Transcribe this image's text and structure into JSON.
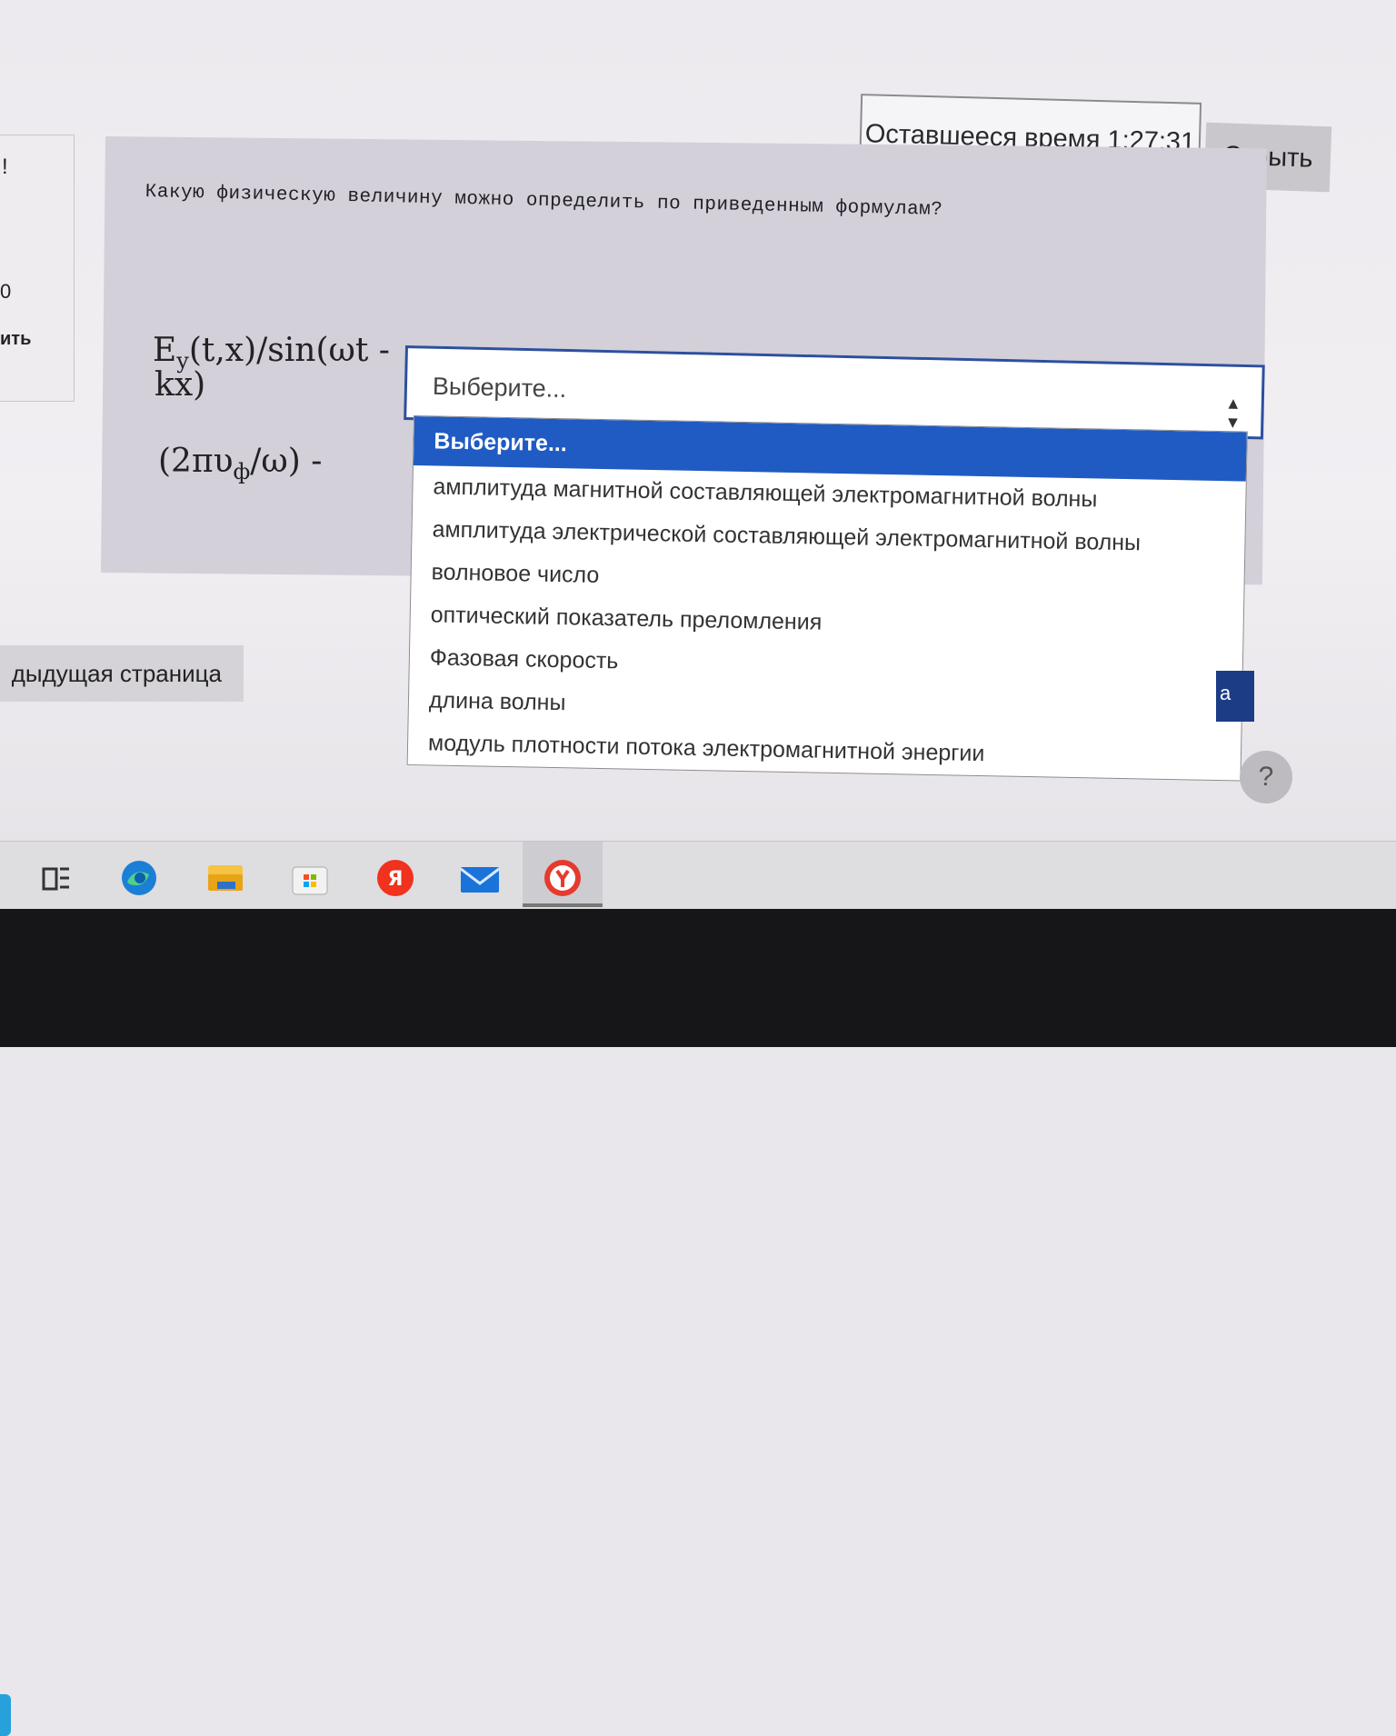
{
  "left_nav": {
    "number": "0",
    "link_fragment": "ить"
  },
  "timer": {
    "label": "Оставшееся время 1:27:31",
    "hide_button": "Скрыть"
  },
  "question": {
    "text": "Какую физическую величину можно определить по приведенным формулам?",
    "formula1_line1": "E",
    "formula1_sub": "y",
    "formula1_rest1": "(t,x)/sin(ωt -",
    "formula1_line2": "kx)",
    "formula2_pre": "(2πυ",
    "formula2_sub": "ф",
    "formula2_post": "/ω) -"
  },
  "select": {
    "value": "Выберите...",
    "options": [
      "Выберите...",
      "амплитуда магнитной составляющей электромагнитной волны",
      "амплитуда электрической составляющей электромагнитной волны",
      "волновое число",
      "оптический показатель преломления",
      "Фазовая скорость",
      "длина волны",
      "модуль плотности потока электромагнитной энергии"
    ]
  },
  "buttons": {
    "previous_page": "дыдущая страница",
    "next_fragment": "а",
    "help": "?"
  },
  "taskbar": {
    "icons": [
      "task-view-icon",
      "edge-browser-icon",
      "file-explorer-icon",
      "store-icon",
      "yandex-icon",
      "mail-icon",
      "yandex-browser-icon"
    ]
  }
}
